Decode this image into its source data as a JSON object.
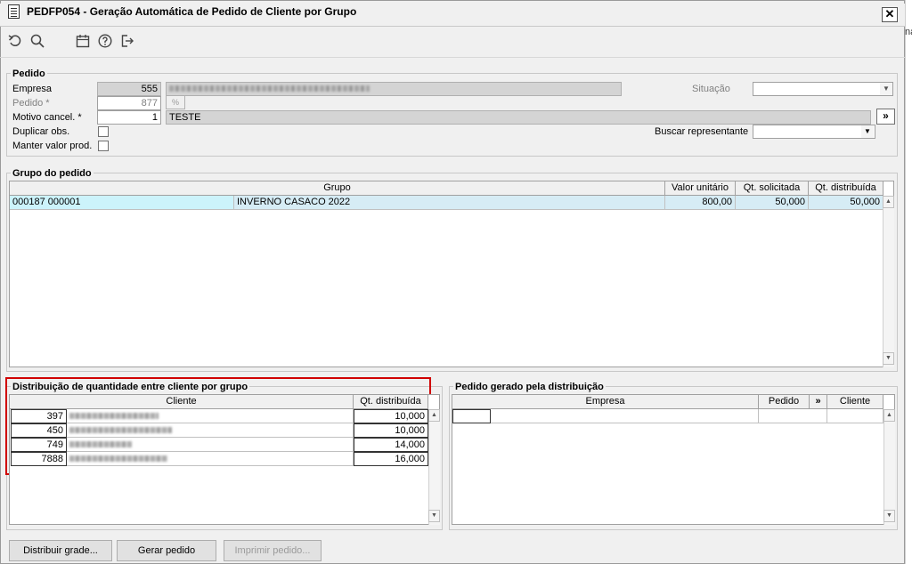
{
  "window": {
    "title": "PEDFP054 - Geração Automática de Pedido de Cliente por Grupo",
    "close_label": "✕"
  },
  "side": {
    "text": "na"
  },
  "toolbar": {
    "icons": [
      "undo-icon",
      "search-icon",
      "calendar-icon",
      "help-icon",
      "exit-icon"
    ]
  },
  "pedido": {
    "title": "Pedido",
    "empresa_label": "Empresa",
    "empresa_code": "555",
    "pedido_label": "Pedido *",
    "pedido_value": "877",
    "motivo_label": "Motivo cancel. *",
    "motivo_code": "1",
    "motivo_desc": "TESTE",
    "duplicar_label": "Duplicar obs.",
    "manter_label": "Manter valor prod.",
    "situacao_label": "Situação",
    "situacao_value": "",
    "buscar_label": "Buscar representante",
    "buscar_value": "",
    "more_label": "»"
  },
  "grupo": {
    "title": "Grupo do pedido",
    "columns": [
      "Grupo",
      "Valor unitário",
      "Qt. solicitada",
      "Qt. distribuída"
    ],
    "rows": [
      {
        "codigo": "000187 000001",
        "grupo": "INVERNO CASACO 2022",
        "valor": "800,00",
        "solicitada": "50,000",
        "distribuida": "50,000"
      }
    ]
  },
  "distribuicao": {
    "title": "Distribuição de quantidade entre cliente por grupo",
    "columns": [
      "Cliente",
      "Qt. distribuída"
    ],
    "rows": [
      {
        "codigo": "397",
        "qtd": "10,000"
      },
      {
        "codigo": "450",
        "qtd": "10,000"
      },
      {
        "codigo": "749",
        "qtd": "14,000"
      },
      {
        "codigo": "7888",
        "qtd": "16,000"
      }
    ]
  },
  "gerado": {
    "title": "Pedido gerado pela distribuição",
    "columns": [
      "Empresa",
      "Pedido",
      "»",
      "Cliente"
    ]
  },
  "buttons": {
    "distribuir": "Distribuir grade...",
    "gerar": "Gerar pedido",
    "imprimir": "Imprimir pedido..."
  },
  "colors": {
    "selection": "#ccf3fb",
    "highlight": "#d00000"
  }
}
